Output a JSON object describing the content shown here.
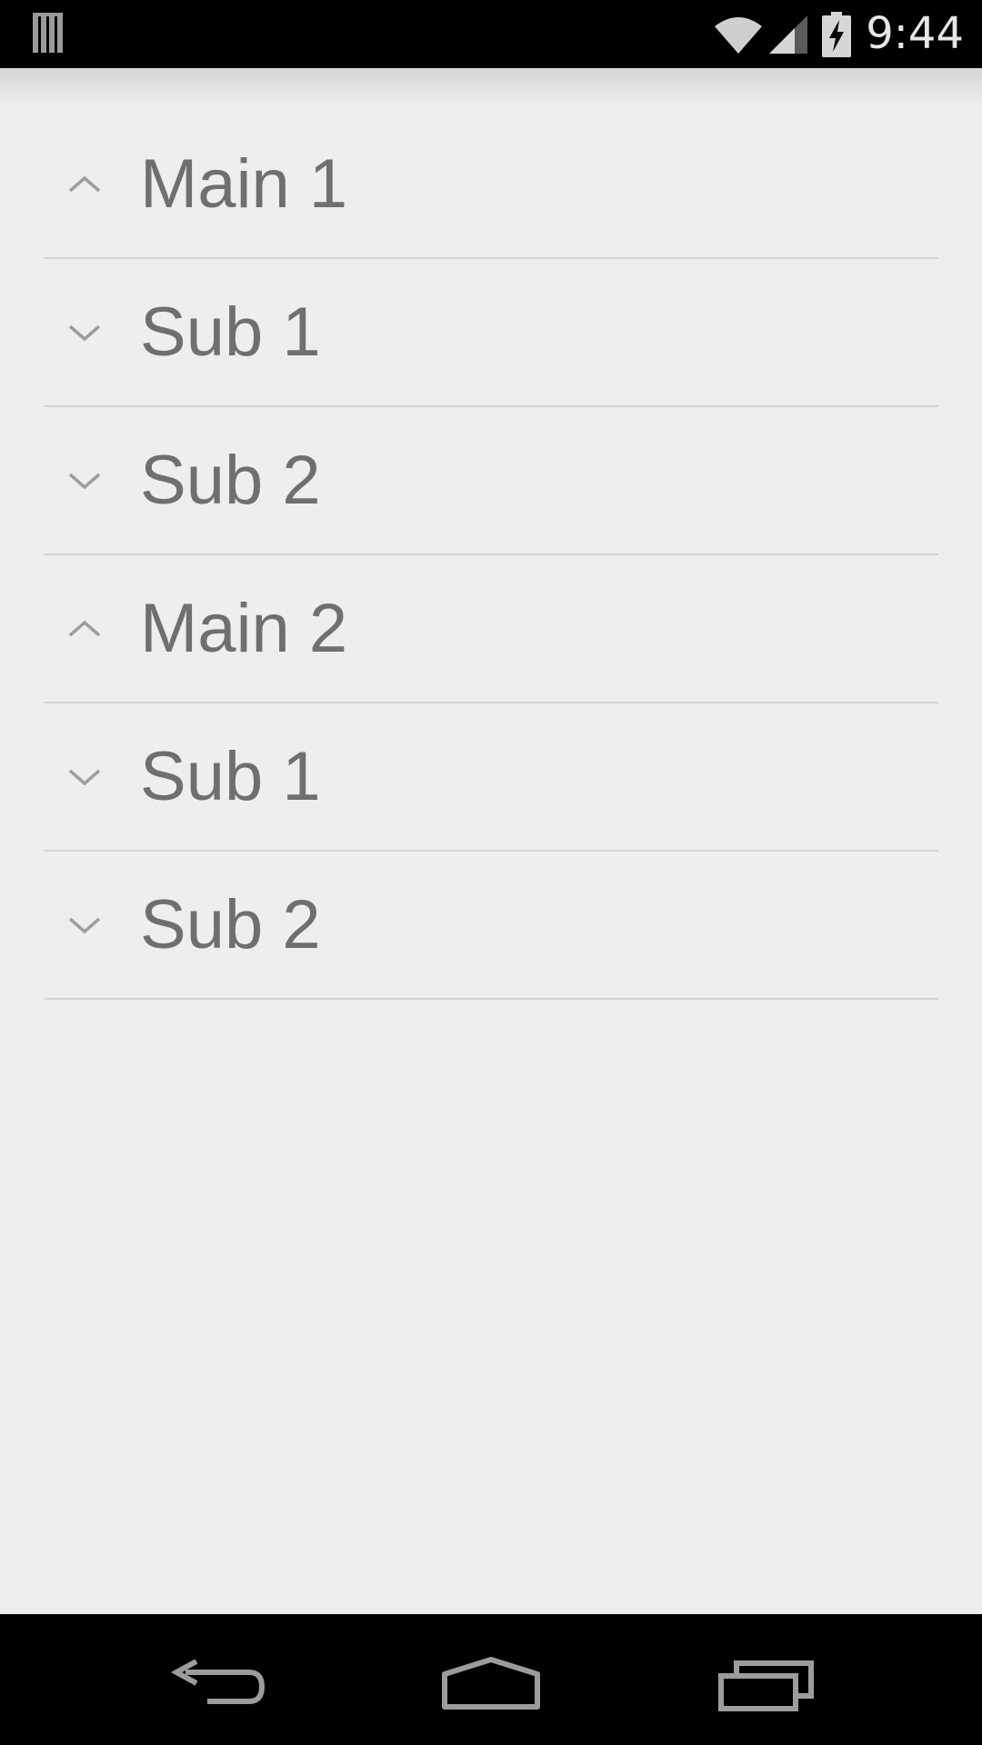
{
  "status_bar": {
    "time": "9:44",
    "left_icon": "notification-storage-icon",
    "icons": [
      "wifi-icon",
      "cell-signal-icon",
      "battery-charging-icon"
    ]
  },
  "list": {
    "items": [
      {
        "label": "Main 1",
        "type": "group",
        "chevron": "chevron-up-icon"
      },
      {
        "label": "Sub 1",
        "type": "child",
        "chevron": "chevron-down-icon"
      },
      {
        "label": "Sub 2",
        "type": "child",
        "chevron": "chevron-down-icon"
      },
      {
        "label": "Main 2",
        "type": "group",
        "chevron": "chevron-up-icon"
      },
      {
        "label": "Sub 1",
        "type": "child",
        "chevron": "chevron-down-icon"
      },
      {
        "label": "Sub 2",
        "type": "child",
        "chevron": "chevron-down-icon"
      }
    ]
  },
  "nav_bar": {
    "buttons": [
      "back-icon",
      "home-icon",
      "recents-icon"
    ]
  },
  "colors": {
    "background": "#eeeeee",
    "label_text": "#6f6f6f",
    "chevron": "#9e9e9e",
    "divider": "#d4d4d4",
    "system_bars": "#000000"
  }
}
